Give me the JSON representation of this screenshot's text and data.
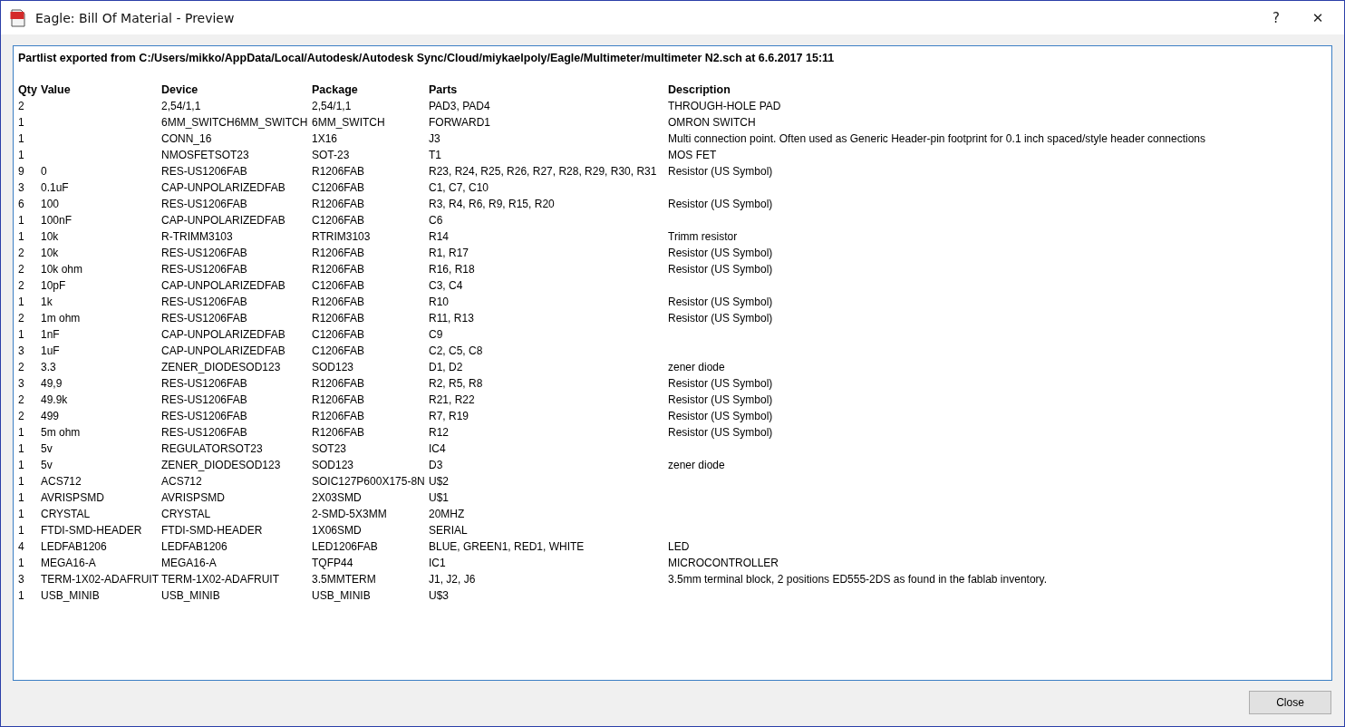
{
  "window": {
    "title": "Eagle: Bill Of Material - Preview"
  },
  "report": {
    "heading": "Partlist exported from C:/Users/mikko/AppData/Local/Autodesk/Autodesk Sync/Cloud/miykaelpoly/Eagle/Multimeter/multimeter N2.sch at 6.6.2017 15:11",
    "columns": [
      "Qty",
      "Value",
      "Device",
      "Package",
      "Parts",
      "Description"
    ],
    "rows": [
      {
        "qty": "2",
        "device": "2,54/1,1",
        "package": "2,54/1,1",
        "parts": "PAD3, PAD4",
        "description": "THROUGH-HOLE PAD"
      },
      {
        "qty": "1",
        "device": "6MM_SWITCH6MM_SWITCH",
        "package": "6MM_SWITCH",
        "parts": "FORWARD1",
        "description": "OMRON SWITCH"
      },
      {
        "qty": "1",
        "device": "CONN_16",
        "package": "1X16",
        "parts": "J3",
        "description": "Multi connection point. Often used as Generic Header-pin footprint for 0.1 inch spaced/style header connections"
      },
      {
        "qty": "1",
        "device": "NMOSFETSOT23",
        "package": "SOT-23",
        "parts": "T1",
        "description": "MOS FET"
      },
      {
        "qty": "9",
        "value": "0",
        "device": "RES-US1206FAB",
        "package": "R1206FAB",
        "parts": "R23, R24, R25, R26, R27, R28, R29, R30, R31",
        "description": "Resistor (US Symbol)"
      },
      {
        "qty": "3",
        "value": "0.1uF",
        "device": "CAP-UNPOLARIZEDFAB",
        "package": "C1206FAB",
        "parts": "C1, C7, C10"
      },
      {
        "qty": "6",
        "value": "100",
        "device": "RES-US1206FAB",
        "package": "R1206FAB",
        "parts": "R3, R4, R6, R9, R15, R20",
        "description": "Resistor (US Symbol)"
      },
      {
        "qty": "1",
        "value": "100nF",
        "device": "CAP-UNPOLARIZEDFAB",
        "package": "C1206FAB",
        "parts": "C6"
      },
      {
        "qty": "1",
        "value": "10k",
        "device": "R-TRIMM3103",
        "package": "RTRIM3103",
        "parts": "R14",
        "description": "Trimm resistor"
      },
      {
        "qty": "2",
        "value": "10k",
        "device": "RES-US1206FAB",
        "package": "R1206FAB",
        "parts": "R1, R17",
        "description": "Resistor (US Symbol)"
      },
      {
        "qty": "2",
        "value": "10k ohm",
        "device": "RES-US1206FAB",
        "package": "R1206FAB",
        "parts": "R16, R18",
        "description": "Resistor (US Symbol)"
      },
      {
        "qty": "2",
        "value": "10pF",
        "device": "CAP-UNPOLARIZEDFAB",
        "package": "C1206FAB",
        "parts": "C3, C4"
      },
      {
        "qty": "1",
        "value": "1k",
        "device": "RES-US1206FAB",
        "package": "R1206FAB",
        "parts": "R10",
        "description": "Resistor (US Symbol)"
      },
      {
        "qty": "2",
        "value": "1m ohm",
        "device": "RES-US1206FAB",
        "package": "R1206FAB",
        "parts": "R11, R13",
        "description": "Resistor (US Symbol)"
      },
      {
        "qty": "1",
        "value": "1nF",
        "device": "CAP-UNPOLARIZEDFAB",
        "package": "C1206FAB",
        "parts": "C9"
      },
      {
        "qty": "3",
        "value": "1uF",
        "device": "CAP-UNPOLARIZEDFAB",
        "package": "C1206FAB",
        "parts": "C2, C5, C8"
      },
      {
        "qty": "2",
        "value": "3.3",
        "device": "ZENER_DIODESOD123",
        "package": "SOD123",
        "parts": "D1, D2",
        "description": "zener diode"
      },
      {
        "qty": "3",
        "value": "49,9",
        "device": "RES-US1206FAB",
        "package": "R1206FAB",
        "parts": "R2, R5, R8",
        "description": "Resistor (US Symbol)"
      },
      {
        "qty": "2",
        "value": "49.9k",
        "device": "RES-US1206FAB",
        "package": "R1206FAB",
        "parts": "R21, R22",
        "description": "Resistor (US Symbol)"
      },
      {
        "qty": "2",
        "value": "499",
        "device": "RES-US1206FAB",
        "package": "R1206FAB",
        "parts": "R7, R19",
        "description": "Resistor (US Symbol)"
      },
      {
        "qty": "1",
        "value": "5m ohm",
        "device": "RES-US1206FAB",
        "package": "R1206FAB",
        "parts": "R12",
        "description": "Resistor (US Symbol)"
      },
      {
        "qty": "1",
        "value": "5v",
        "device": "REGULATORSOT23",
        "package": "SOT23",
        "parts": "IC4"
      },
      {
        "qty": "1",
        "value": "5v",
        "device": "ZENER_DIODESOD123",
        "package": "SOD123",
        "parts": "D3",
        "description": "zener diode"
      },
      {
        "qty": "1",
        "value": "ACS712",
        "device": "ACS712",
        "package": "SOIC127P600X175-8N",
        "parts": "U$2"
      },
      {
        "qty": "1",
        "value": "AVRISPSMD",
        "device": "AVRISPSMD",
        "package": "2X03SMD",
        "parts": "U$1"
      },
      {
        "qty": "1",
        "value": "CRYSTAL",
        "device": "CRYSTAL",
        "package": "2-SMD-5X3MM",
        "parts": "20MHZ"
      },
      {
        "qty": "1",
        "value": "FTDI-SMD-HEADER",
        "device": "FTDI-SMD-HEADER",
        "package": "1X06SMD",
        "parts": "SERIAL"
      },
      {
        "qty": "4",
        "value": "LEDFAB1206",
        "device": "LEDFAB1206",
        "package": "LED1206FAB",
        "parts": "BLUE, GREEN1, RED1, WHITE",
        "description": "LED"
      },
      {
        "qty": "1",
        "value": "MEGA16-A",
        "device": "MEGA16-A",
        "package": "TQFP44",
        "parts": "IC1",
        "description": "MICROCONTROLLER"
      },
      {
        "qty": "3",
        "value": "TERM-1X02-ADAFRUIT",
        "device": "TERM-1X02-ADAFRUIT",
        "package": "3.5MMTERM",
        "parts": "J1, J2, J6",
        "description": "3.5mm terminal block, 2 positions ED555-2DS as found in the fablab inventory."
      },
      {
        "qty": "1",
        "value": "USB_MINIB",
        "device": "USB_MINIB",
        "package": "USB_MINIB",
        "parts": "U$3"
      }
    ]
  },
  "buttons": {
    "help": "?",
    "close_glyph": "✕",
    "close": "Close"
  }
}
